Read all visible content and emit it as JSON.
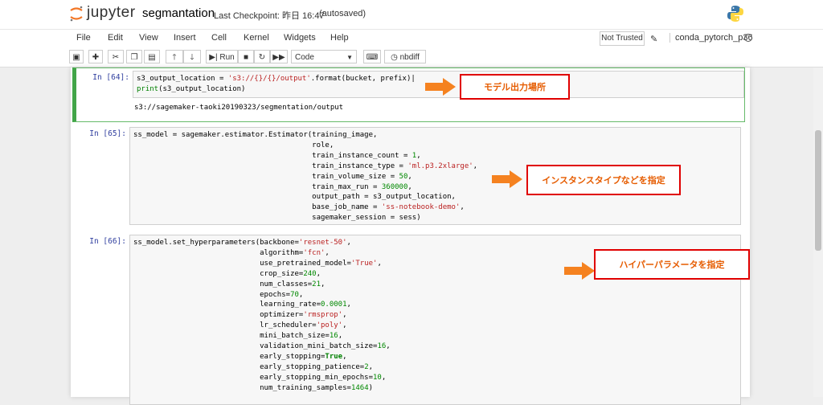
{
  "header": {
    "logo_text": "jupyter",
    "notebook_name": "segmantation",
    "checkpoint": "Last Checkpoint: 昨日 16:47",
    "autosave": "(autosaved)"
  },
  "menu": {
    "items": [
      "File",
      "Edit",
      "View",
      "Insert",
      "Cell",
      "Kernel",
      "Widgets",
      "Help"
    ],
    "trust": "Not Trusted",
    "kernel": "conda_pytorch_p36"
  },
  "toolbar": {
    "run_label": "Run",
    "cell_type": "Code",
    "nbdiff_label": "nbdiff"
  },
  "cells": [
    {
      "prompt": "In [64]:",
      "output": "s3://sagemaker-taoki20190323/segmentation/output"
    },
    {
      "prompt": "In [65]:"
    },
    {
      "prompt": "In [66]:"
    }
  ],
  "annotations": [
    {
      "text": "モデル出力場所"
    },
    {
      "text": "インスタンスタイプなどを指定"
    },
    {
      "text": "ハイパーパラメータを指定"
    }
  ],
  "colors": {
    "annotation_border": "#e00000",
    "annotation_text": "#e65c00",
    "arrow": "#f58220",
    "selected_cell": "#42a548"
  }
}
